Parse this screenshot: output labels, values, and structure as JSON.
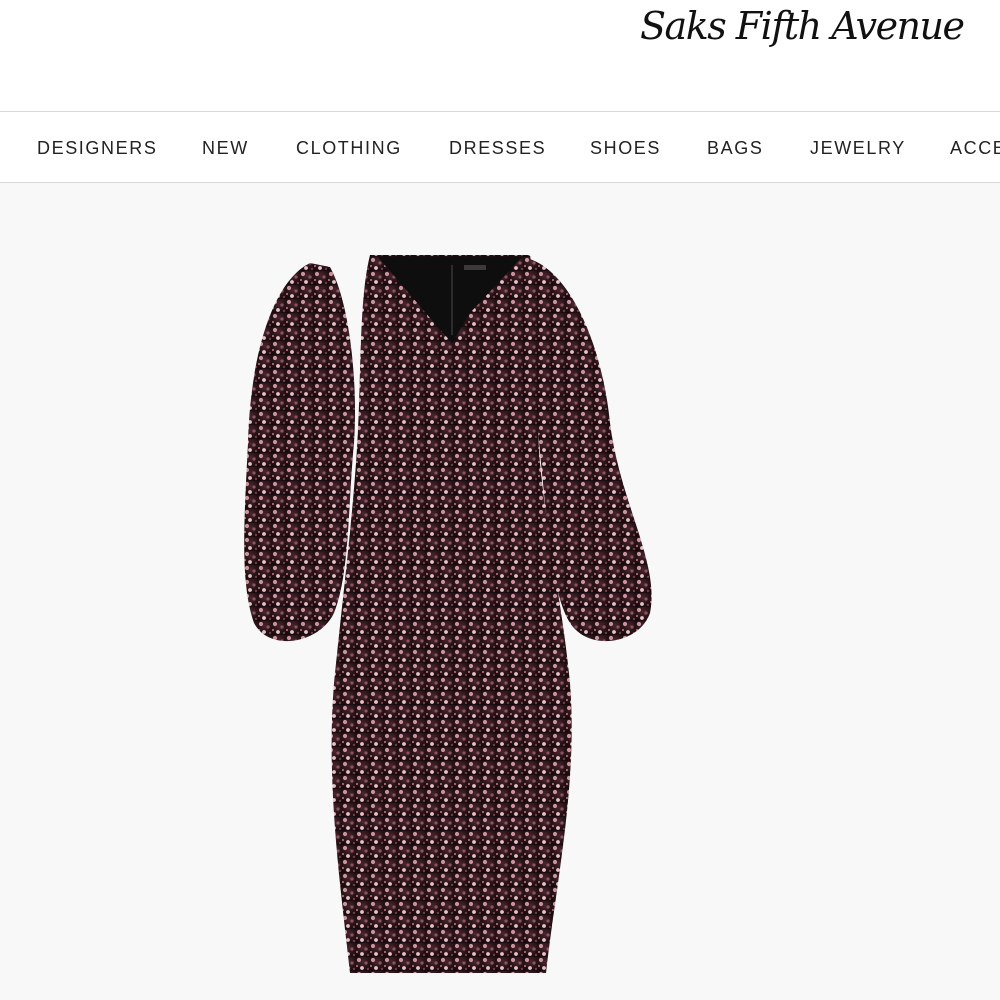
{
  "header": {
    "logo_text": "Saks Fifth Avenue"
  },
  "nav": {
    "items": [
      {
        "label": "DESIGNERS"
      },
      {
        "label": "NEW"
      },
      {
        "label": "CLOTHING"
      },
      {
        "label": "DRESSES"
      },
      {
        "label": "SHOES"
      },
      {
        "label": "BAGS"
      },
      {
        "label": "JEWELRY"
      },
      {
        "label": "ACCE"
      }
    ]
  },
  "product": {
    "image_icon": "sequin-dress-image",
    "colors": {
      "dress_base": "#2a1418",
      "sequin_highlight": "#d9a8b0",
      "lining": "#0e0e0e",
      "background": "#f8f8f8"
    }
  }
}
